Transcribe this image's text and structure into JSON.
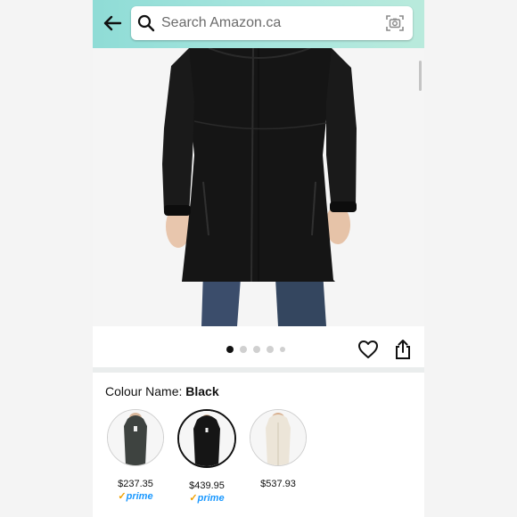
{
  "header": {
    "search_placeholder": "Search Amazon.ca"
  },
  "product": {
    "image_count": 5,
    "active_image": 1
  },
  "colour": {
    "label": "Colour Name:",
    "selected": "Black"
  },
  "swatches": [
    {
      "name": "Dark Grey",
      "price": "$237.35",
      "prime": true,
      "color": "#3e4340"
    },
    {
      "name": "Black",
      "price": "$439.95",
      "prime": true,
      "color": "#151515",
      "selected": true
    },
    {
      "name": "Cream",
      "price": "$537.93",
      "prime": false,
      "color": "#ece5d8"
    }
  ],
  "prime_label": "prime",
  "colors": {
    "header_start": "#8fdcd6",
    "header_end": "#b9eadc",
    "prime_blue": "#1a98ff",
    "coat_black": "#151515"
  }
}
